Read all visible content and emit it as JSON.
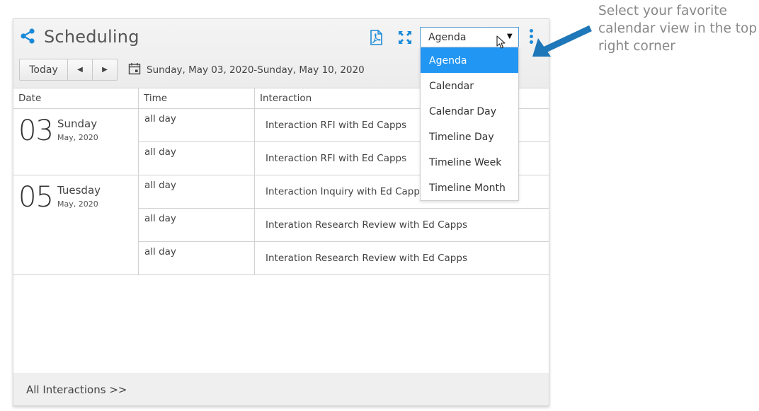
{
  "header": {
    "title": "Scheduling",
    "view_select": {
      "value": "Agenda"
    },
    "icons": [
      "share-icon",
      "pdf-icon",
      "expand-icon",
      "more-vert-icon",
      "calendar-icon"
    ]
  },
  "toolbar": {
    "today_label": "Today",
    "prev_label": "◀",
    "next_label": "▶",
    "date_range": "Sunday, May 03, 2020-Sunday, May 10, 2020"
  },
  "table": {
    "columns": [
      "Date",
      "Time",
      "Interaction"
    ],
    "days": [
      {
        "day_number": "03",
        "weekday": "Sunday",
        "month_year": "May, 2020",
        "events": [
          {
            "time": "all day",
            "interaction": "Interaction RFI with Ed Capps"
          },
          {
            "time": "all day",
            "interaction": "Interaction RFI with Ed Capps"
          }
        ]
      },
      {
        "day_number": "05",
        "weekday": "Tuesday",
        "month_year": "May, 2020",
        "events": [
          {
            "time": "all day",
            "interaction": "Interaction Inquiry with Ed Capps"
          },
          {
            "time": "all day",
            "interaction": "Interation Research Review with Ed Capps"
          },
          {
            "time": "all day",
            "interaction": "Interation Research Review with Ed Capps"
          }
        ]
      }
    ]
  },
  "dropdown": {
    "options": [
      "Agenda",
      "Calendar",
      "Calendar Day",
      "Timeline Day",
      "Timeline Week",
      "Timeline Month"
    ],
    "selected_index": 0
  },
  "footer": {
    "link_label": "All Interactions >>"
  },
  "callout": {
    "text": "Select your favorite calendar view in the top right corner"
  },
  "colors": {
    "accent": "#1a8ad8",
    "selected": "#2196f3",
    "arrow": "#1e77b8"
  }
}
